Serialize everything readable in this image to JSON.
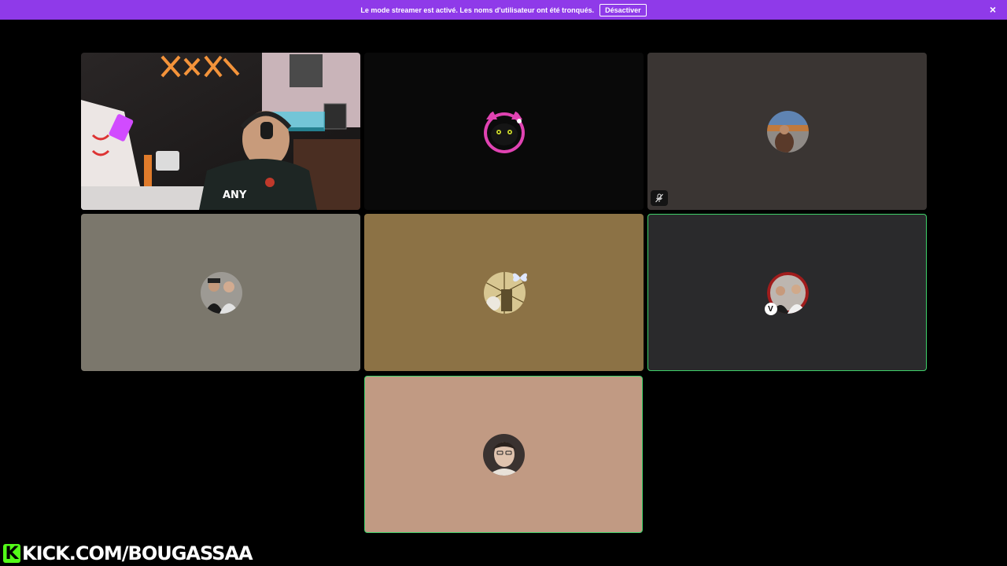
{
  "banner": {
    "message": "Le mode streamer est activé. Les noms d'utilisateur ont été tronqués.",
    "button_label": "Désactiver",
    "close_glyph": "×",
    "color": "#8f3ae9"
  },
  "tiles": [
    {
      "kind": "camera",
      "content": "streamer webcam with headset, LED wall lights"
    },
    {
      "kind": "avatar",
      "background": "#090909",
      "avatar": "black cat with pink cat-ear headphones"
    },
    {
      "kind": "avatar",
      "background": "#3a3533",
      "avatar": "landscape photo",
      "muted": true,
      "muted_icon": "mic-off-icon"
    },
    {
      "kind": "avatar",
      "background": "#7b776c",
      "avatar": "two men photo"
    },
    {
      "kind": "avatar",
      "background": "#8c7245",
      "avatar": "decorative collage with butterfly"
    },
    {
      "kind": "avatar",
      "background": "#2a2a2c",
      "avatar": "group photo",
      "speaking": true,
      "badge": "V"
    },
    {
      "kind": "avatar",
      "background": "#c19a83",
      "avatar": "young man portrait",
      "speaking": true
    }
  ],
  "speaking_color": "#3fd16a",
  "watermark": {
    "k_glyph": "K",
    "text": "KICK.COM/BOUGASSAA",
    "accent": "#53fc18"
  }
}
